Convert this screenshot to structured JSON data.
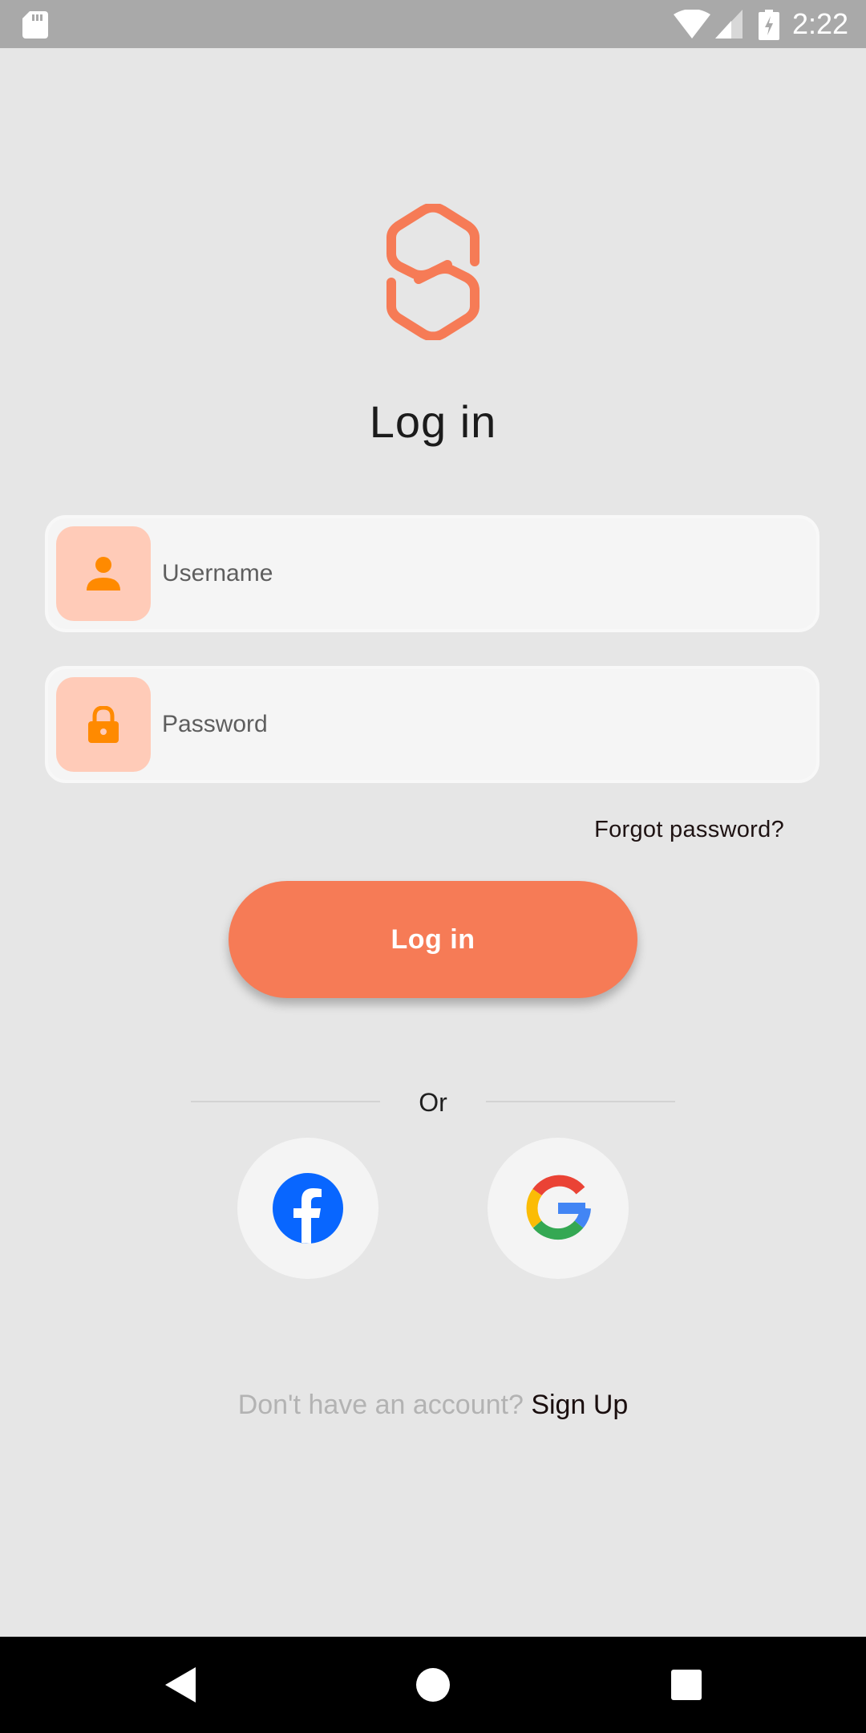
{
  "status_bar": {
    "time": "2:22",
    "icons": [
      "sd-card-icon",
      "wifi-icon",
      "cell-signal-icon",
      "battery-charging-icon"
    ]
  },
  "logo": {
    "icon": "s-chain-logo-icon",
    "color": "#f67b56"
  },
  "title": "Log in",
  "form": {
    "username": {
      "placeholder": "Username",
      "value": "",
      "icon": "person-icon"
    },
    "password": {
      "placeholder": "Password",
      "value": "",
      "icon": "lock-icon"
    },
    "forgot_password": "Forgot password?",
    "submit_label": "Log in"
  },
  "divider": {
    "label": "Or"
  },
  "social": [
    {
      "name": "facebook",
      "icon": "facebook-icon"
    },
    {
      "name": "google",
      "icon": "google-icon"
    }
  ],
  "signup": {
    "prompt": "Don't have an account?",
    "link": "Sign Up"
  },
  "nav_bar": {
    "buttons": [
      "back-icon",
      "home-icon",
      "recents-icon"
    ]
  },
  "colors": {
    "accent": "#f67b56",
    "icon_orange": "#ff8a00",
    "icon_tile": "#ffcbb8",
    "background": "#e6e6e6",
    "status_bar": "#a9a9a9"
  }
}
